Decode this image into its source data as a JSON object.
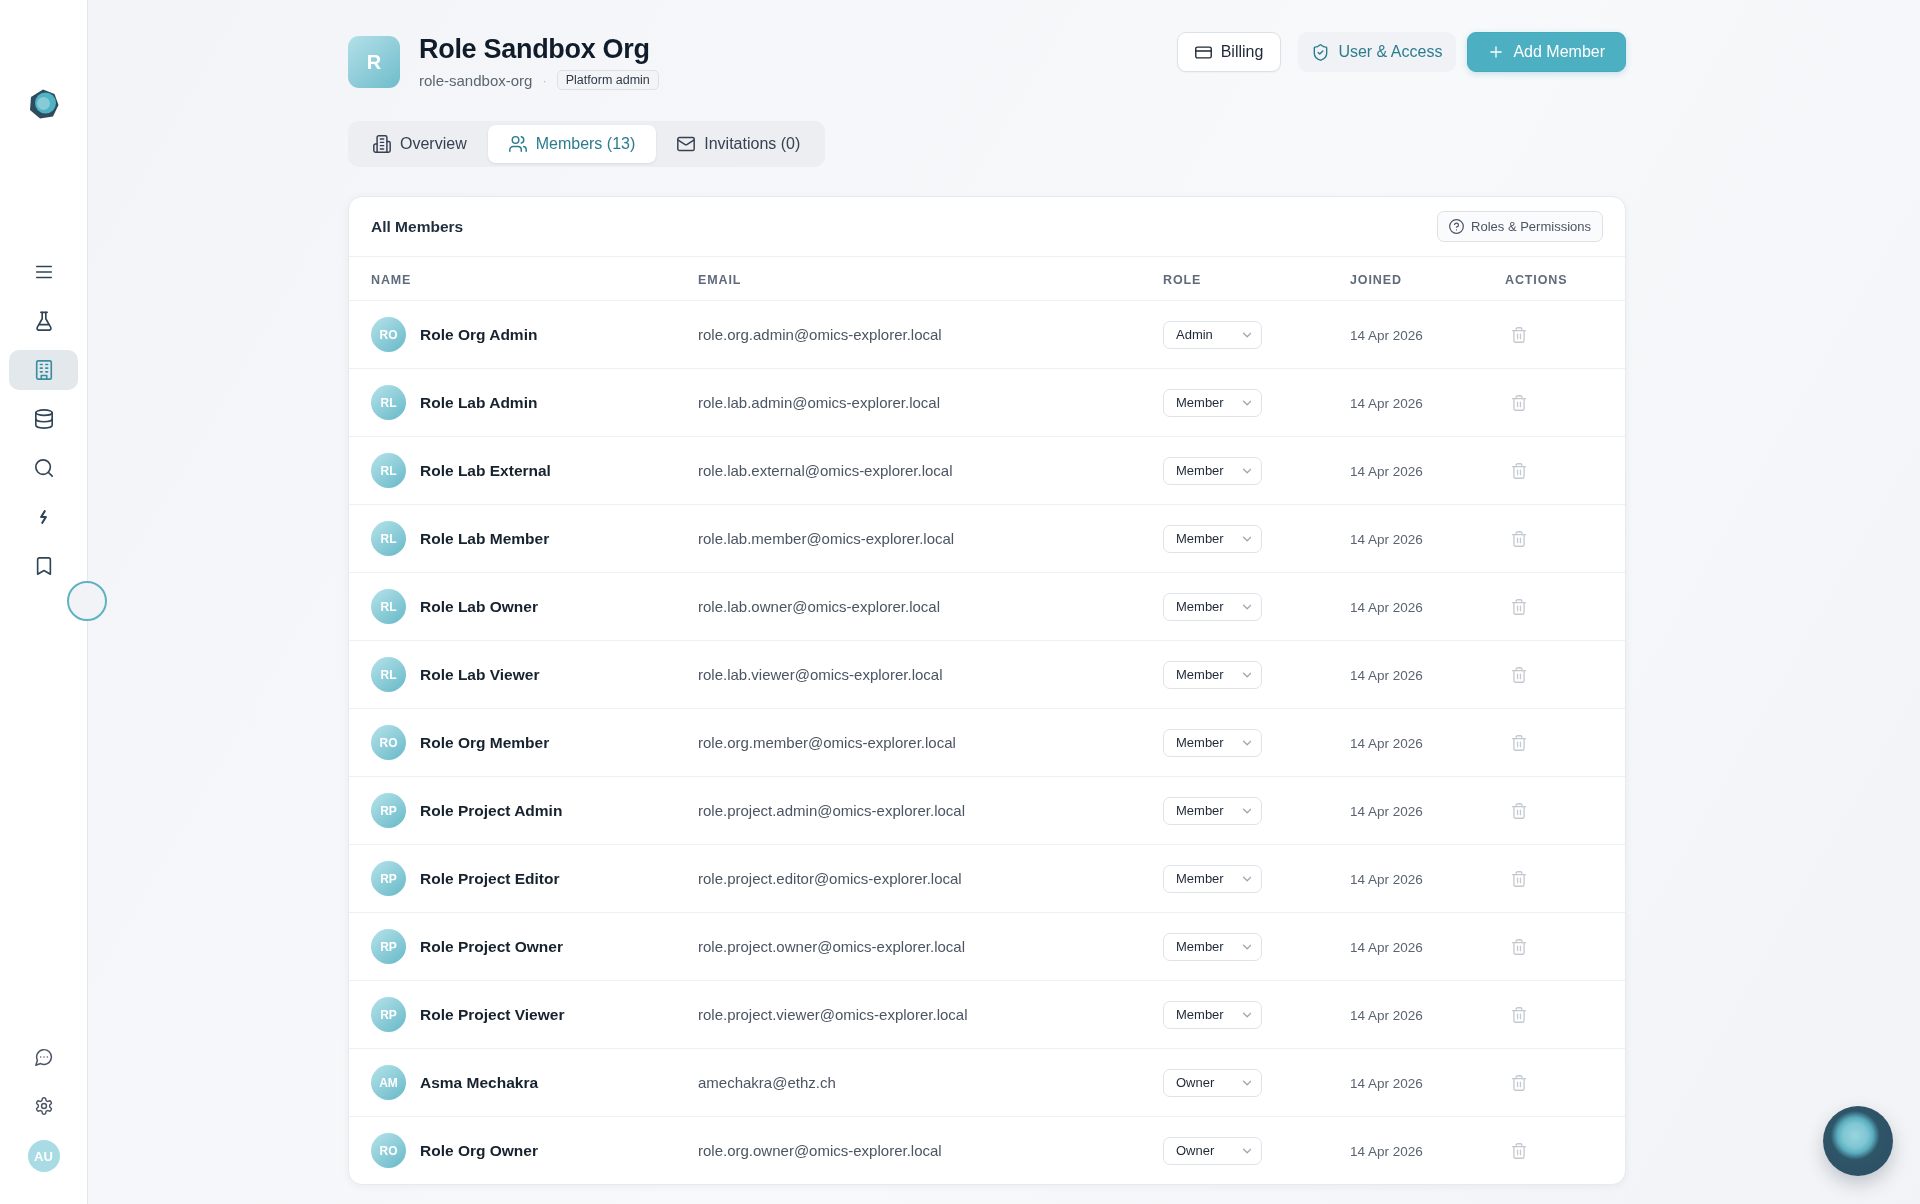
{
  "sidebar": {
    "nav_items": [
      {
        "kind": "menu",
        "selected": false
      },
      {
        "kind": "flask",
        "selected": false
      },
      {
        "kind": "building",
        "selected": true
      },
      {
        "kind": "database",
        "selected": false
      },
      {
        "kind": "search",
        "selected": false
      },
      {
        "kind": "bolt",
        "selected": false
      },
      {
        "kind": "bookmark",
        "selected": false
      }
    ],
    "footer_items": [
      {
        "kind": "chat"
      },
      {
        "kind": "settings"
      }
    ],
    "user_avatar": "AU"
  },
  "org": {
    "initial": "R",
    "name": "Role Sandbox Org",
    "slug": "role-sandbox-org",
    "separator": "·",
    "badge": "Platform admin"
  },
  "header_actions": [
    {
      "kind": "billing",
      "label": "Billing"
    },
    {
      "kind": "access",
      "label": "User & Access"
    },
    {
      "kind": "add",
      "label": "Add Member"
    }
  ],
  "tabs": [
    {
      "kind": "overview",
      "label": "Overview",
      "selected": false
    },
    {
      "kind": "members",
      "label": "Members (13)",
      "selected": true
    },
    {
      "kind": "invitations",
      "label": "Invitations (0)",
      "selected": false
    }
  ],
  "members": {
    "title": "All Members",
    "help_button": "Roles & Permissions",
    "columns": [
      "NAME",
      "EMAIL",
      "ROLE",
      "JOINED",
      "ACTIONS"
    ],
    "rows": [
      {
        "initials": "RO",
        "name": "Role Org Admin",
        "email": "role.org.admin@omics-explorer.local",
        "role": "Admin",
        "joined": "14 Apr 2026"
      },
      {
        "initials": "RL",
        "name": "Role Lab Admin",
        "email": "role.lab.admin@omics-explorer.local",
        "role": "Member",
        "joined": "14 Apr 2026"
      },
      {
        "initials": "RL",
        "name": "Role Lab External",
        "email": "role.lab.external@omics-explorer.local",
        "role": "Member",
        "joined": "14 Apr 2026"
      },
      {
        "initials": "RL",
        "name": "Role Lab Member",
        "email": "role.lab.member@omics-explorer.local",
        "role": "Member",
        "joined": "14 Apr 2026"
      },
      {
        "initials": "RL",
        "name": "Role Lab Owner",
        "email": "role.lab.owner@omics-explorer.local",
        "role": "Member",
        "joined": "14 Apr 2026"
      },
      {
        "initials": "RL",
        "name": "Role Lab Viewer",
        "email": "role.lab.viewer@omics-explorer.local",
        "role": "Member",
        "joined": "14 Apr 2026"
      },
      {
        "initials": "RO",
        "name": "Role Org Member",
        "email": "role.org.member@omics-explorer.local",
        "role": "Member",
        "joined": "14 Apr 2026"
      },
      {
        "initials": "RP",
        "name": "Role Project Admin",
        "email": "role.project.admin@omics-explorer.local",
        "role": "Member",
        "joined": "14 Apr 2026"
      },
      {
        "initials": "RP",
        "name": "Role Project Editor",
        "email": "role.project.editor@omics-explorer.local",
        "role": "Member",
        "joined": "14 Apr 2026"
      },
      {
        "initials": "RP",
        "name": "Role Project Owner",
        "email": "role.project.owner@omics-explorer.local",
        "role": "Member",
        "joined": "14 Apr 2026"
      },
      {
        "initials": "RP",
        "name": "Role Project Viewer",
        "email": "role.project.viewer@omics-explorer.local",
        "role": "Member",
        "joined": "14 Apr 2026"
      },
      {
        "initials": "AM",
        "name": "Asma Mechakra",
        "email": "amechakra@ethz.ch",
        "role": "Owner",
        "joined": "14 Apr 2026"
      },
      {
        "initials": "RO",
        "name": "Role Org Owner",
        "email": "role.org.owner@omics-explorer.local",
        "role": "Owner",
        "joined": "14 Apr 2026"
      }
    ]
  }
}
